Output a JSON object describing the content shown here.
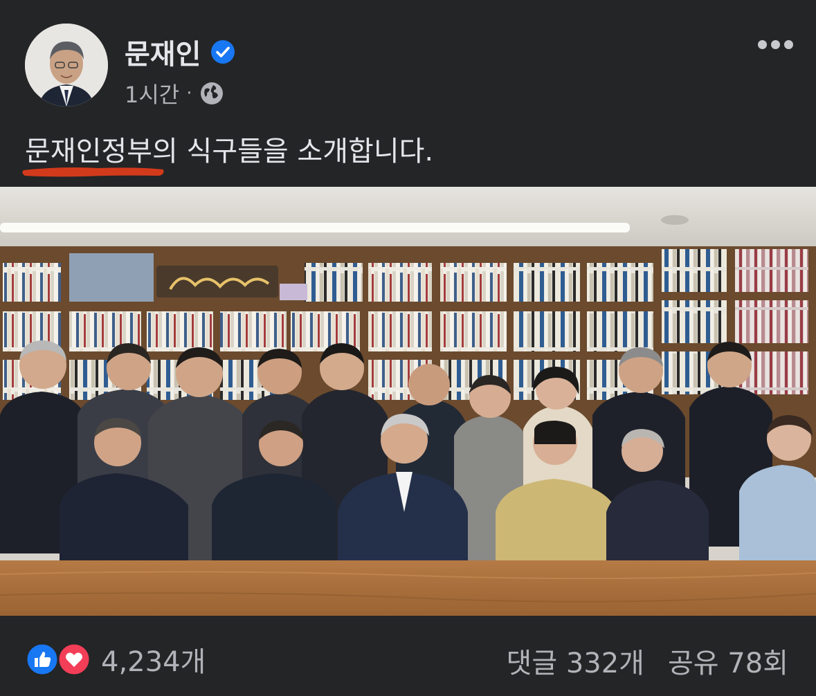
{
  "post": {
    "author": "문재인",
    "time": "1시간",
    "separator": "·",
    "caption": "문재인정부의 식구들을 소개합니다.",
    "icons": {
      "verified": "verified-badge-icon",
      "audience": "globe-icon",
      "more": "more-options-icon"
    }
  },
  "colors": {
    "background": "#242526",
    "text": "#e4e6eb",
    "muted": "#b0b3b8",
    "verified": "#1877f2",
    "like": "#1877f2",
    "love": "#f33e58",
    "annotation": "#d23a1c"
  },
  "footer": {
    "reactions_count": "4,234개",
    "comments": "댓글 332개",
    "shares": "공유 78회",
    "reaction_icons": [
      "like-icon",
      "love-icon"
    ]
  }
}
